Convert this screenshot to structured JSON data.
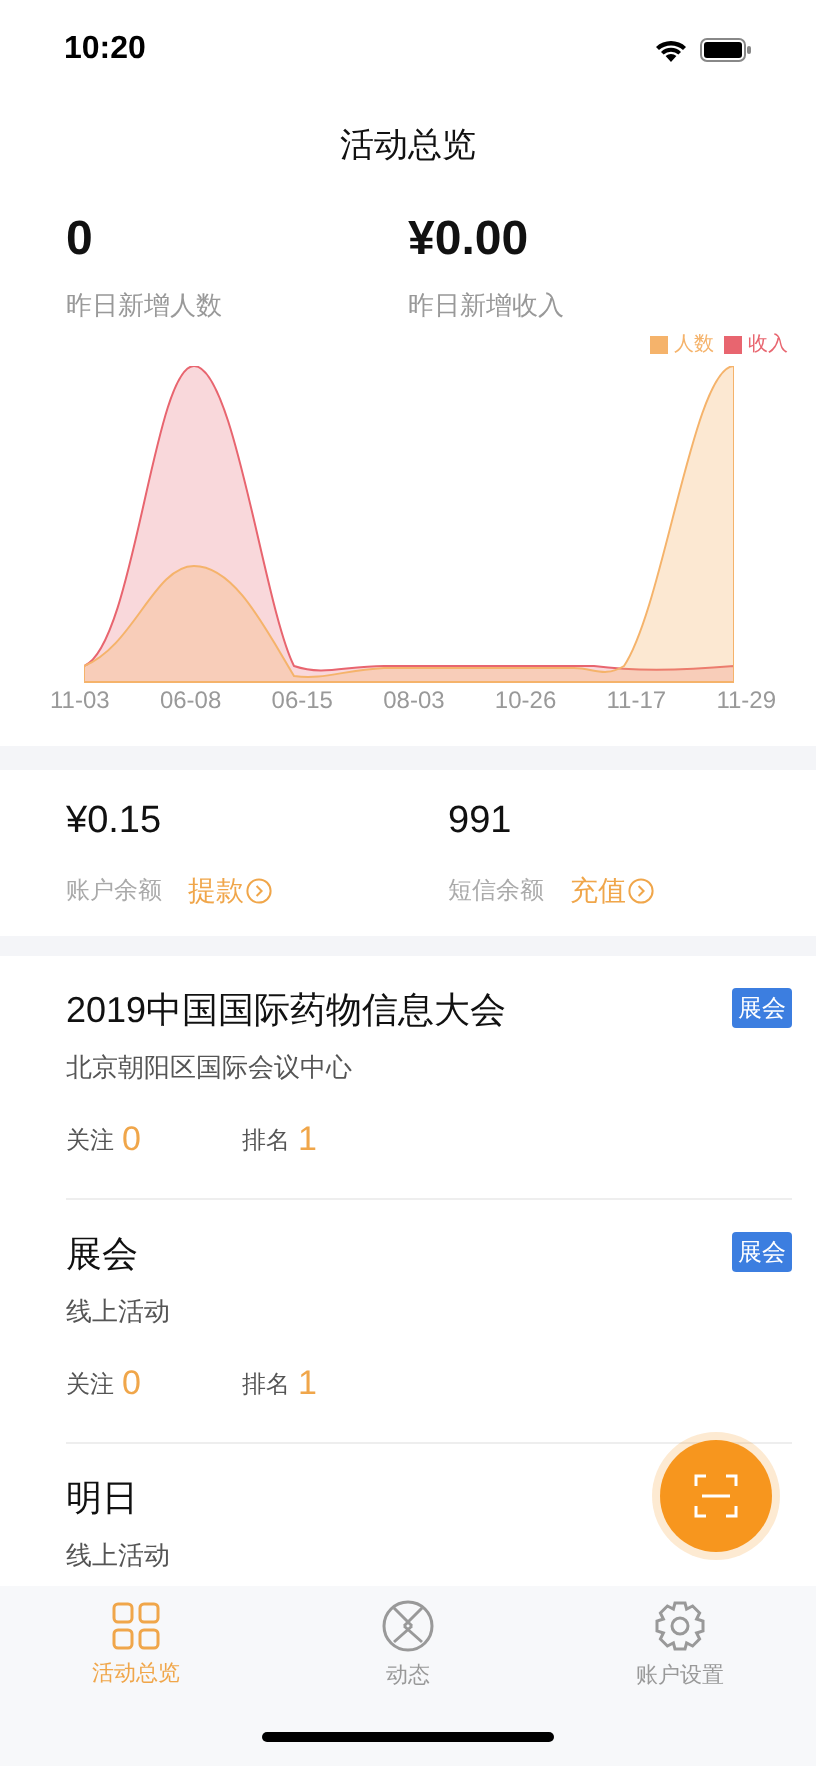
{
  "status_bar": {
    "time": "10:20"
  },
  "nav": {
    "title": "活动总览"
  },
  "stats": [
    {
      "value": "0",
      "label": "昨日新增人数"
    },
    {
      "value": "¥0.00",
      "label": "昨日新增收入"
    }
  ],
  "chart": {
    "legend": [
      {
        "label": "人数",
        "color": "#f5b36b"
      },
      {
        "label": "收入",
        "color": "#e8656f"
      }
    ],
    "x_labels": [
      "11-03",
      "06-08",
      "06-15",
      "08-03",
      "10-26",
      "11-17",
      "11-29"
    ]
  },
  "balances": [
    {
      "value": "¥0.15",
      "label": "账户余额",
      "action": "提款"
    },
    {
      "value": "991",
      "label": "短信余额",
      "action": "充值"
    }
  ],
  "events": [
    {
      "title": "2019中国国际药物信息大会",
      "location": "北京朝阳区国际会议中心",
      "tag": "展会",
      "follow_label": "关注",
      "follow": "0",
      "rank_label": "排名",
      "rank": "1"
    },
    {
      "title": "展会",
      "location": "线上活动",
      "tag": "展会",
      "follow_label": "关注",
      "follow": "0",
      "rank_label": "排名",
      "rank": "1"
    },
    {
      "title": "明日",
      "location": "线上活动"
    }
  ],
  "tabs": [
    {
      "label": "活动总览",
      "selected": true
    },
    {
      "label": "动态",
      "selected": false
    },
    {
      "label": "账户设置",
      "selected": false
    }
  ]
}
